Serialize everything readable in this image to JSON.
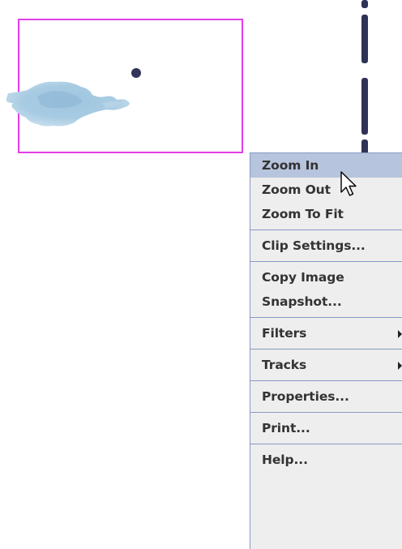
{
  "viewer": {
    "clip_border_color": "#e23ee6",
    "track_color": "#2f3257"
  },
  "context_menu": {
    "items": [
      {
        "label": "Zoom In"
      },
      {
        "label": "Zoom Out"
      },
      {
        "label": "Zoom To Fit"
      },
      {
        "label": "Clip Settings..."
      },
      {
        "label": "Copy Image"
      },
      {
        "label": "Snapshot..."
      },
      {
        "label": "Filters",
        "submenu": true
      },
      {
        "label": "Tracks",
        "submenu": true
      },
      {
        "label": "Properties..."
      },
      {
        "label": "Print..."
      },
      {
        "label": "Help..."
      }
    ],
    "highlighted_item": "Zoom In"
  },
  "cursor": {
    "icon": "arrow-pointer-icon"
  }
}
